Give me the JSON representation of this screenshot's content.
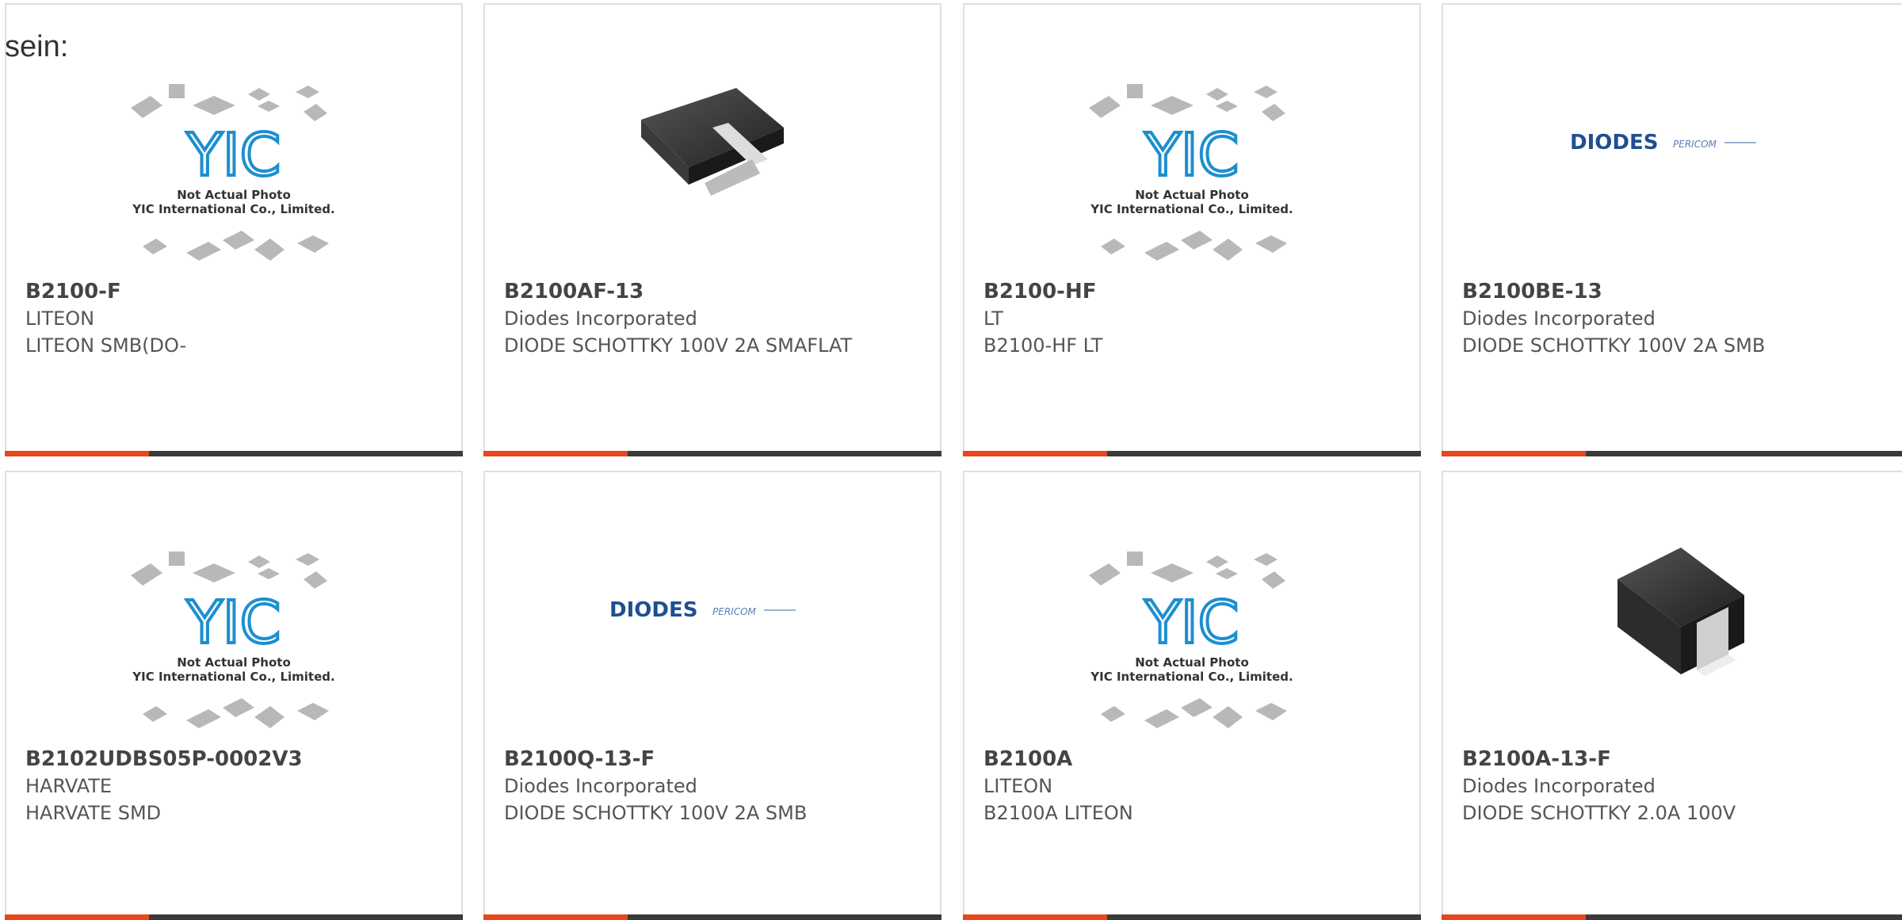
{
  "intro": "sein:",
  "products": [
    {
      "part": "B2100-F",
      "maker": "LITEON",
      "desc": "LITEON SMB(DO-",
      "image": "yic-placeholder"
    },
    {
      "part": "B2100AF-13",
      "maker": "Diodes Incorporated",
      "desc": "DIODE SCHOTTKY 100V 2A SMAFLAT",
      "image": "smaflat-package-photo"
    },
    {
      "part": "B2100-HF",
      "maker": "LT",
      "desc": "B2100-HF LT",
      "image": "yic-placeholder"
    },
    {
      "part": "B2100BE-13",
      "maker": "Diodes Incorporated",
      "desc": "DIODE SCHOTTKY 100V 2A SMB",
      "image": "diodes-pericom-logo"
    },
    {
      "part": "B2102UDBS05P-0002V3",
      "maker": "HARVATE",
      "desc": "HARVATE SMD",
      "image": "yic-placeholder"
    },
    {
      "part": "B2100Q-13-F",
      "maker": "Diodes Incorporated",
      "desc": "DIODE SCHOTTKY 100V 2A SMB",
      "image": "diodes-pericom-logo"
    },
    {
      "part": "B2100A",
      "maker": "LITEON",
      "desc": "B2100A LITEON",
      "image": "yic-placeholder"
    },
    {
      "part": "B2100A-13-F",
      "maker": "Diodes Incorporated",
      "desc": "DIODE SCHOTTKY 2.0A 100V",
      "image": "sma-package-photo"
    }
  ],
  "placeholder": {
    "logo": "YIC",
    "line1": "Not Actual Photo",
    "line2": "YIC International Co., Limited."
  },
  "brand_logo": {
    "main": "DIODES",
    "sub": "PERICOM"
  },
  "colors": {
    "accent": "#e8461b",
    "bar": "#3a3a3a",
    "logo_blue": "#1c8fd0"
  }
}
